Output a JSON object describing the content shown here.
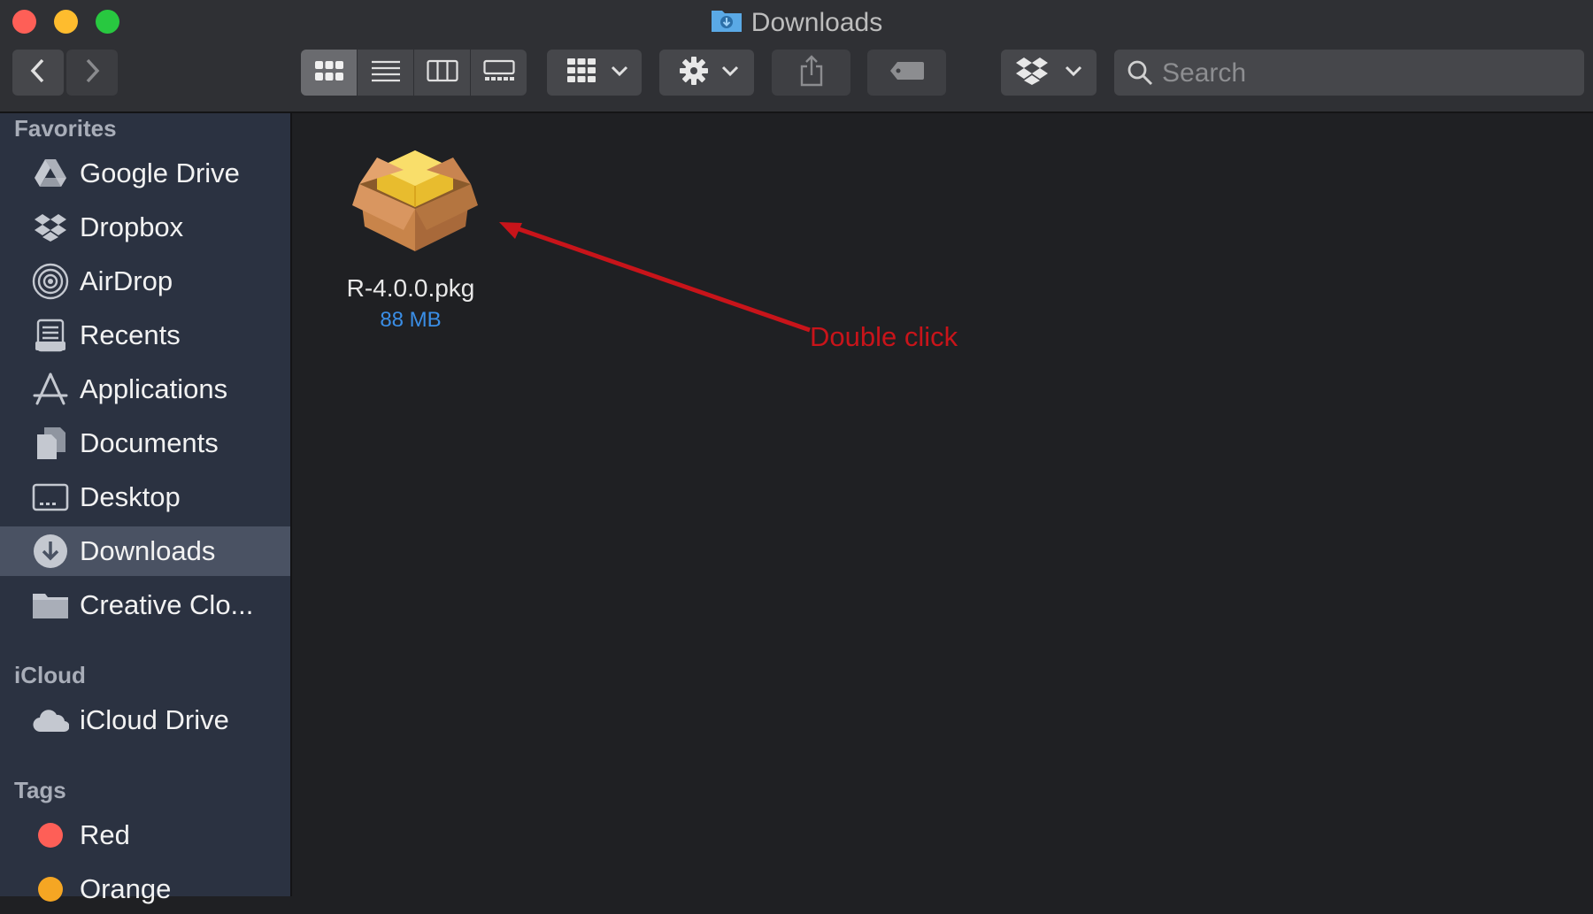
{
  "window": {
    "title": "Downloads"
  },
  "toolbar": {
    "back_icon": "chevron-left-icon",
    "forward_icon": "chevron-right-icon",
    "view_modes": [
      "icon-view",
      "list-view",
      "column-view",
      "gallery-view"
    ],
    "active_view": "icon-view",
    "search_placeholder": "Search"
  },
  "sidebar": {
    "favorites_header": "Favorites",
    "favorites": [
      {
        "label": "Google Drive",
        "icon": "google-drive-icon"
      },
      {
        "label": "Dropbox",
        "icon": "dropbox-icon"
      },
      {
        "label": "AirDrop",
        "icon": "airdrop-icon"
      },
      {
        "label": "Recents",
        "icon": "recents-icon"
      },
      {
        "label": "Applications",
        "icon": "applications-icon"
      },
      {
        "label": "Documents",
        "icon": "documents-icon"
      },
      {
        "label": "Desktop",
        "icon": "desktop-icon"
      },
      {
        "label": "Downloads",
        "icon": "downloads-icon",
        "active": true
      },
      {
        "label": "Creative Clo...",
        "icon": "folder-icon"
      }
    ],
    "icloud_header": "iCloud",
    "icloud": [
      {
        "label": "iCloud Drive",
        "icon": "cloud-icon"
      }
    ],
    "tags_header": "Tags",
    "tags": [
      {
        "label": "Red",
        "color": "#fe5f57"
      },
      {
        "label": "Orange",
        "color": "#f5a623"
      }
    ]
  },
  "content": {
    "files": [
      {
        "name": "R-4.0.0.pkg",
        "size": "88 MB",
        "icon": "package-icon"
      }
    ],
    "annotation": "Double click",
    "annotation_color": "#c8141a"
  },
  "colors": {
    "accent": "#3a8ee6",
    "sidebar_bg": "#2b3241",
    "content_bg": "#1f2023"
  }
}
